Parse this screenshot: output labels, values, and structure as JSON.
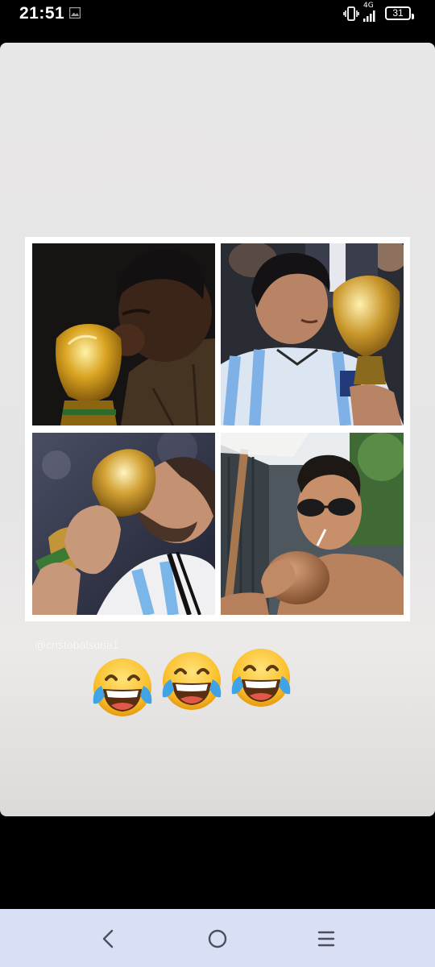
{
  "status_bar": {
    "time": "21:51",
    "network": "4G",
    "battery": "31",
    "icons": [
      "gallery-icon",
      "vibrate-icon",
      "signal-icon",
      "battery-icon"
    ]
  },
  "story": {
    "handle": "@cristobalsoria1",
    "photos": [
      "photo-player-kissing-trophy-1",
      "photo-player-kissing-trophy-2",
      "photo-player-kissing-trophy-3",
      "photo-player-drinking-coconut"
    ],
    "emojis": [
      "face-with-tears-of-joy",
      "face-with-tears-of-joy",
      "face-with-tears-of-joy"
    ]
  },
  "nav_bar": {
    "buttons": [
      "back-icon",
      "home-icon",
      "menu-icon"
    ],
    "background": "#d9dff5"
  }
}
